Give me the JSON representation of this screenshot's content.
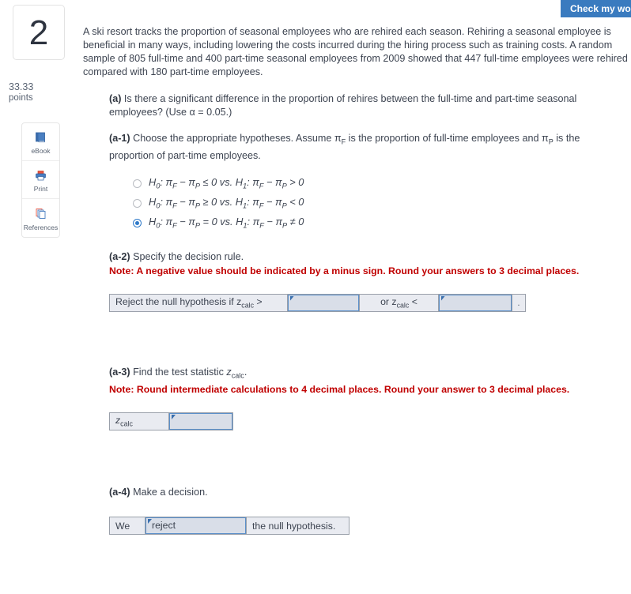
{
  "header": {
    "check_my_work_label": "Check my work"
  },
  "sidebar": {
    "question_number": "2",
    "points_value": "33.33",
    "points_label": "points",
    "tools": [
      {
        "icon": "ebook-icon",
        "label": "eBook"
      },
      {
        "icon": "printer-icon",
        "label": "Print"
      },
      {
        "icon": "references-icon",
        "label": "References"
      }
    ]
  },
  "question": {
    "stem": "A ski resort tracks the proportion of seasonal employees who are rehired each season. Rehiring a seasonal employee is beneficial in many ways, including lowering the costs incurred during the hiring process such as training costs. A random sample of 805 full-time and 400 part-time seasonal employees from 2009 showed that 447 full-time employees were rehired compared with 180 part-time employees.",
    "part_a": {
      "label": "(a)",
      "text": "Is there a significant difference in the proportion of rehires between the full-time and part-time seasonal employees? (Use α = 0.05.)"
    },
    "part_a1": {
      "label": "(a-1)",
      "text_before": "Choose the appropriate hypotheses. Assume ",
      "pi_f": "πF",
      "text_middle": " is the proportion of full-time employees and ",
      "pi_p": "πP",
      "text_after": " is the proportion of part-time employees.",
      "options": [
        {
          "id": "opt1",
          "text": "H0: πF − πP ≤ 0 vs. H1: πF − πP > 0",
          "selected": false
        },
        {
          "id": "opt2",
          "text": "H0: πF − πP ≥ 0 vs. H1: πF − πP < 0",
          "selected": false
        },
        {
          "id": "opt3",
          "text": "H0: πF − πP = 0 vs. H1: πF − πP ≠ 0",
          "selected": true
        }
      ]
    },
    "part_a2": {
      "label": "(a-2)",
      "text": "Specify the decision rule.",
      "note": "Note: A negative value should be indicated by a minus sign. Round your answers to 3 decimal places.",
      "rule_prefix": "Reject the null hypothesis if z",
      "rule_prefix_sub": "calc",
      "rule_prefix_op": " >",
      "field1_value": "",
      "rule_middle": "or z",
      "rule_middle_sub": "calc",
      "rule_middle_op": " <",
      "field2_value": "",
      "trailing": "."
    },
    "part_a3": {
      "label": "(a-3)",
      "text_before": "Find the test statistic ",
      "zcalc": "zcalc",
      "text_after": ".",
      "note": "Note: Round intermediate calculations to 4 decimal places. Round your answer to 3 decimal places.",
      "row_label": "z",
      "row_label_sub": "calc",
      "field_value": ""
    },
    "part_a4": {
      "label": "(a-4)",
      "text": "Make a decision.",
      "prefix": "We",
      "decision_value": "reject",
      "suffix": "the null hypothesis."
    }
  },
  "colors": {
    "accent_blue": "#3a7bbf",
    "note_red": "#c00000",
    "field_fill": "#d9dee8",
    "field_border": "#5b8fc9",
    "table_fill": "#e9ebf1"
  }
}
